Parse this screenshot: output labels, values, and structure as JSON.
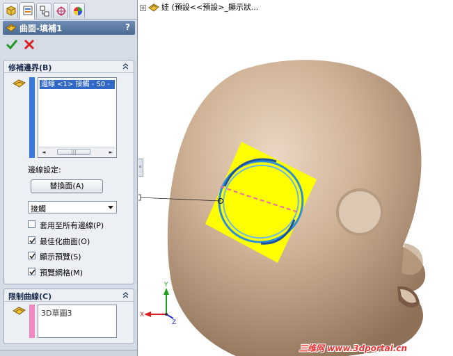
{
  "feature_manager": {
    "tabs": [
      {
        "name": "feature-manager-tab"
      },
      {
        "name": "property-manager-tab"
      },
      {
        "name": "configuration-manager-tab"
      },
      {
        "name": "dimxpert-manager-tab"
      },
      {
        "name": "display-manager-tab"
      }
    ]
  },
  "property_manager": {
    "title": "曲面-填補1",
    "help": "?"
  },
  "patch_boundary": {
    "title": "修補邊界(B)",
    "selected_item": "邊線 <1> 接觸 - S0 -",
    "edge_settings_label": "邊線設定:",
    "replace_face_button": "替換面(A)",
    "contact_select_value": "接觸",
    "apply_all_edges": {
      "label": "套用至所有邊線(P)",
      "checked": false
    },
    "optimize_surface": {
      "label": "最佳化曲面(O)",
      "checked": true
    },
    "show_preview": {
      "label": "顯示預覽(S)",
      "checked": true
    },
    "preview_mesh": {
      "label": "預覽網格(M)",
      "checked": true
    }
  },
  "constraint_curves": {
    "title": "限制曲線(C)",
    "item": "3D草圖3"
  },
  "viewport": {
    "tree_label": "娃 (預設<<預設>_顯示狀...",
    "axis_labels": {
      "x": "X",
      "y": "Y",
      "z": "Z"
    },
    "watermark": "三维网 www.3dportal.cn"
  },
  "colors": {
    "accent": "#3168c8",
    "head_skin": "#c9ab8e",
    "patch_yellow": "#ffff00",
    "boundary_blue": "#2a8fd8",
    "constraint_pink": "#ef8ac0",
    "watermark_red": "#e33333"
  }
}
